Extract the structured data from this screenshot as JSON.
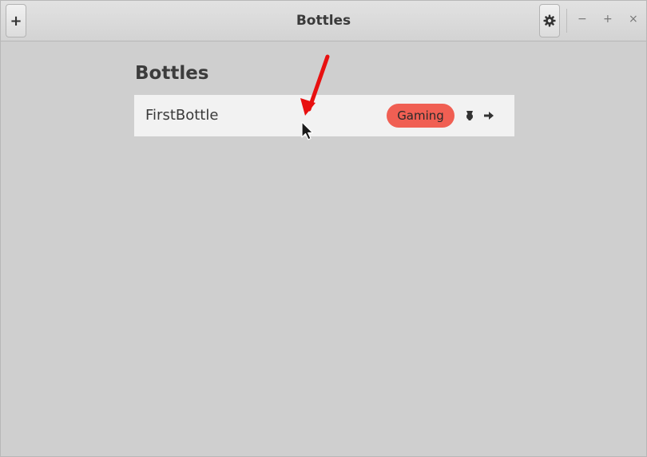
{
  "window": {
    "title": "Bottles",
    "add_label": "+",
    "controls": {
      "minimize": "−",
      "maximize": "+",
      "close": "×"
    }
  },
  "main": {
    "heading": "Bottles",
    "bottles": [
      {
        "name": "FirstBottle",
        "environment": "Gaming"
      }
    ]
  },
  "colors": {
    "badge": "#f05f53",
    "annotation_arrow": "#e81010",
    "background": "#cfcfcf",
    "row": "#f2f2f2"
  },
  "icons": {
    "settings": "gear-icon",
    "run": "flask-icon",
    "open": "arrow-right-icon"
  }
}
